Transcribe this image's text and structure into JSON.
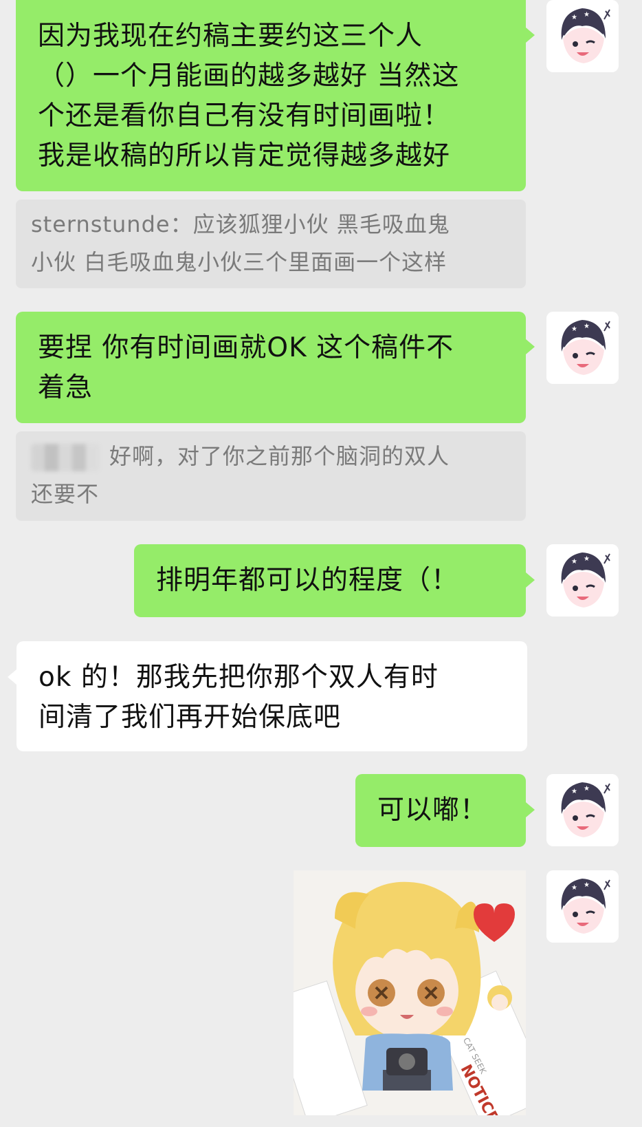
{
  "messages": [
    {
      "id": "m1",
      "side": "right",
      "type": "text",
      "lines": [
        "因为我现在约稿主要约这三个人",
        "（）一个月能画的越多越好 当然这",
        "个还是看你自己有没有时间画啦！",
        "我是收稿的所以肯定觉得越多越好"
      ]
    },
    {
      "id": "q1",
      "type": "quote",
      "sender": "sternstunde：",
      "lines": [
        "应该狐狸小伙 黑毛吸血鬼",
        "小伙 白毛吸血鬼小伙三个里面画一个这样"
      ]
    },
    {
      "id": "m2",
      "side": "right",
      "type": "text",
      "lines": [
        "要捏 你有时间画就OK 这个稿件不",
        "着急"
      ]
    },
    {
      "id": "q2",
      "type": "quote",
      "lines": [
        "好啊，对了你之前那个脑洞的双人",
        "还要不"
      ]
    },
    {
      "id": "m3",
      "side": "right",
      "type": "text",
      "lines": [
        "排明年都可以的程度（！"
      ]
    },
    {
      "id": "m4",
      "side": "left",
      "type": "text",
      "lines": [
        "ok 的！那我先把你那个双人有时",
        "间清了我们再开始保底吧"
      ]
    },
    {
      "id": "m5",
      "side": "right",
      "type": "text",
      "lines": [
        "可以嘟！"
      ]
    },
    {
      "id": "m6",
      "side": "right",
      "type": "sticker",
      "sticker_text": [
        "NOTICE",
        "CAT SEEK"
      ]
    }
  ],
  "colors": {
    "background": "#ededed",
    "self_bubble": "#95ec69",
    "other_bubble": "#ffffff",
    "quote_bg": "#e2e2e2",
    "quote_text": "#7a7a7a"
  },
  "icons": {
    "avatar": "anime-avatar-icon",
    "sticker": "cartoon-character-sticker"
  }
}
